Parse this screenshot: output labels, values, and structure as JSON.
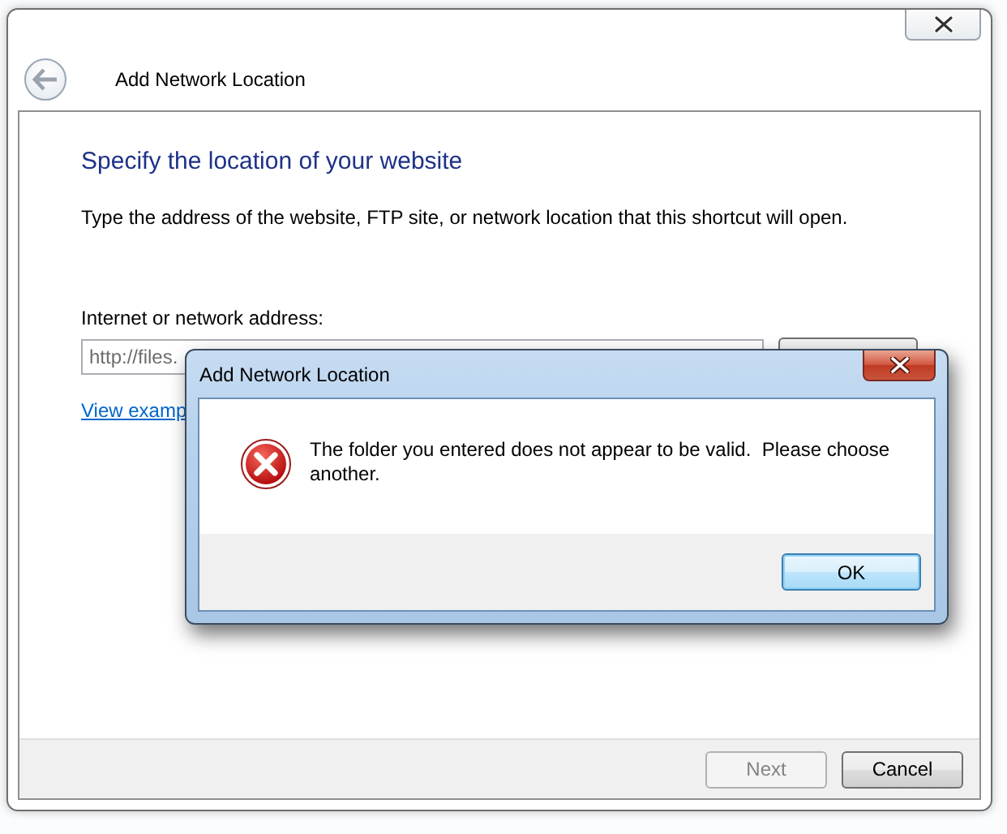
{
  "window": {
    "title": "Add Network Location",
    "heading": "Specify the location of your website",
    "description": "Type the address of the website, FTP site, or network location that this shortcut will open.",
    "address_label": "Internet or network address:",
    "address_value": "http://files.",
    "link": "View examp",
    "buttons": [
      {
        "label": "Next",
        "disabled": true
      },
      {
        "label": "Cancel",
        "disabled": false
      }
    ]
  },
  "error_dialog": {
    "title": "Add Network Location",
    "message": "The folder you entered does not appear to be valid.  Please choose another.",
    "buttons": [
      {
        "label": "OK",
        "default": true
      }
    ]
  }
}
